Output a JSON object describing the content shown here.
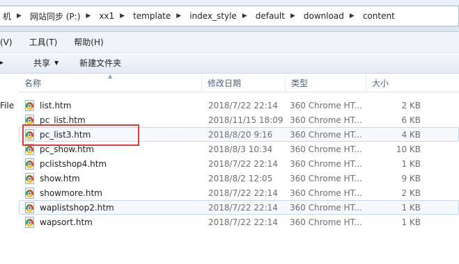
{
  "address": {
    "crumbs": [
      "机",
      "网站同步 (P:)",
      "xx1",
      "template",
      "index_style",
      "default",
      "download",
      "content"
    ]
  },
  "menu": {
    "items": [
      "(V)",
      "工具(T)",
      "帮助(H)"
    ]
  },
  "toolbar": {
    "partial_label": "▸",
    "share_label": "共享",
    "new_folder_label": "新建文件夹"
  },
  "nav": {
    "partial_label": "File"
  },
  "columns": {
    "name": "名称",
    "date": "修改日期",
    "type": "类型",
    "size": "大小"
  },
  "files": [
    {
      "name": "list.htm",
      "date": "2018/7/22 22:14",
      "type": "360 Chrome HT...",
      "size": "2 KB"
    },
    {
      "name": "pc_list.htm",
      "date": "2018/11/15 18:09",
      "type": "360 Chrome HT...",
      "size": "6 KB"
    },
    {
      "name": "pc_list3.htm",
      "date": "2018/8/20 9:16",
      "type": "360 Chrome HT...",
      "size": "4 KB"
    },
    {
      "name": "pc_show.htm",
      "date": "2018/8/3 10:34",
      "type": "360 Chrome HT...",
      "size": "10 KB"
    },
    {
      "name": "pclistshop4.htm",
      "date": "2018/7/22 22:14",
      "type": "360 Chrome HT...",
      "size": "1 KB"
    },
    {
      "name": "show.htm",
      "date": "2018/8/2 12:05",
      "type": "360 Chrome HT...",
      "size": "9 KB"
    },
    {
      "name": "showmore.htm",
      "date": "2018/7/22 22:14",
      "type": "360 Chrome HT...",
      "size": "2 KB"
    },
    {
      "name": "waplistshop2.htm",
      "date": "2018/7/22 22:14",
      "type": "360 Chrome HT...",
      "size": "1 KB"
    },
    {
      "name": "wapsort.htm",
      "date": "2018/7/22 22:14",
      "type": "360 Chrome HT...",
      "size": "1 KB"
    }
  ],
  "colors": {
    "highlight": "#e0393a",
    "header_text": "#4c607a"
  },
  "icons": {
    "file": "chrome-document-icon",
    "sort": "sort-up-icon",
    "separator": "chevron-right-icon"
  }
}
